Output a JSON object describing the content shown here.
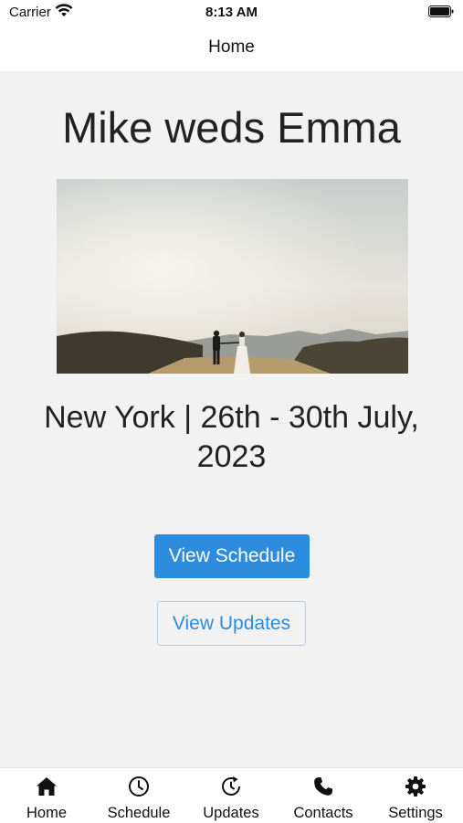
{
  "status_bar": {
    "carrier": "Carrier",
    "time": "8:13 AM"
  },
  "nav": {
    "title": "Home"
  },
  "main": {
    "heading": "Mike weds Emma",
    "subtitle": "New York | 26th - 30th July, 2023",
    "primary_button": "View Schedule",
    "secondary_button": "View Updates"
  },
  "tabs": [
    {
      "label": "Home",
      "icon": "home-icon"
    },
    {
      "label": "Schedule",
      "icon": "clock-icon"
    },
    {
      "label": "Updates",
      "icon": "refresh-clock-icon"
    },
    {
      "label": "Contacts",
      "icon": "phone-icon"
    },
    {
      "label": "Settings",
      "icon": "gear-icon"
    }
  ],
  "colors": {
    "accent": "#2d8cdd",
    "background": "#f2f2f2"
  }
}
